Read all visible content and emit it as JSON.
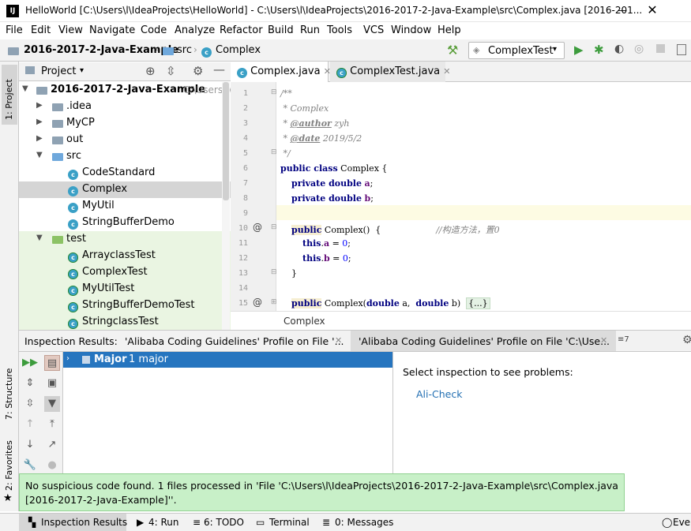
{
  "window": {
    "logo": "IJ",
    "title": "HelloWorld [C:\\Users\\l\\IdeaProjects\\HelloWorld] - C:\\Users\\l\\IdeaProjects\\2016-2017-2-Java-Example\\src\\Complex.java [2016-201...",
    "minimize": "—",
    "close": "✕"
  },
  "menu": [
    "File",
    "Edit",
    "View",
    "Navigate",
    "Code",
    "Analyze",
    "Refactor",
    "Build",
    "Run",
    "Tools",
    "VCS",
    "Window",
    "Help"
  ],
  "nav": {
    "project": "2016-2017-2-Java-Example",
    "folder": "src",
    "file": "Complex",
    "run_config": "ComplexTest"
  },
  "left_strip": {
    "project_tab": "1: Project",
    "structure_tab": "7: Structure",
    "favorites_tab": "2: Favorites"
  },
  "project_panel": {
    "header": "Project",
    "root": "2016-2017-2-Java-Example",
    "root_path": "C:\\Users\\l\\",
    "items": [
      ".idea",
      "MyCP",
      "out",
      "src",
      "CodeStandard",
      "Complex",
      "MyUtil",
      "StringBufferDemo",
      "test",
      "ArrayclassTest",
      "ComplexTest",
      "MyUtilTest",
      "StringBufferDemoTest",
      "StringclassTest"
    ]
  },
  "editor": {
    "tabs": [
      "Complex.java",
      "ComplexTest.java"
    ],
    "line_numbers": [
      "1",
      "2",
      "3",
      "4",
      "5",
      "6",
      "7",
      "8",
      "9",
      "10",
      "11",
      "12",
      "13",
      "14",
      "15"
    ],
    "code": {
      "l1": "/**",
      "l2": " * Complex",
      "l3_tag": "@author",
      "l3_val": " zyh",
      "l4_tag": "@date",
      "l4_val": " 2019/5/2",
      "l5": " */",
      "l6_kw": "public class",
      "l6_rest": " Complex {",
      "l7_kw": "private double",
      "l7_field": "a",
      "l8_kw": "private double",
      "l8_field": "b",
      "l10_kw": "public",
      "l10_rest": " Complex()  {",
      "l10_comment": "//构造方法，置0",
      "l11_kw": "this",
      "l11_field": "a",
      "l11_val": "0",
      "l12_kw": "this",
      "l12_field": "b",
      "l12_val": "0",
      "l13": "}",
      "l15_kw": "public",
      "l15_rest": " Complex(",
      "l15_kw2": "double",
      "l15_a": " a,  ",
      "l15_kw3": "double",
      "l15_b": " b)  ",
      "l15_fold": "{...}"
    },
    "breadcrumb": "Complex"
  },
  "inspection": {
    "label": "Inspection Results:",
    "tab1": "'Alibaba Coding Guidelines' Profile on File '...",
    "tab2": "'Alibaba Coding Guidelines' Profile on File 'C:\\Use...",
    "overflow": "≡7",
    "tree_item": "Major",
    "tree_count": "1 major",
    "detail_prompt": "Select inspection to see problems:",
    "detail_link": "Ali-Check"
  },
  "notification": {
    "line1": "No suspicious code found. 1 files processed in 'File 'C:\\Users\\l\\IdeaProjects\\2016-2017-2-Java-Example\\src\\Complex.java",
    "line2": "[2016-2017-2-Java-Example]''."
  },
  "statusbar": {
    "inspection": "Inspection Results",
    "run": "4: Run",
    "todo": "6: TODO",
    "terminal": "Terminal",
    "messages": "0: Messages",
    "event": "Ever"
  },
  "colors": {
    "selection": "#2675bf",
    "link": "#2470b3",
    "notification_bg": "#c8f0c8"
  }
}
